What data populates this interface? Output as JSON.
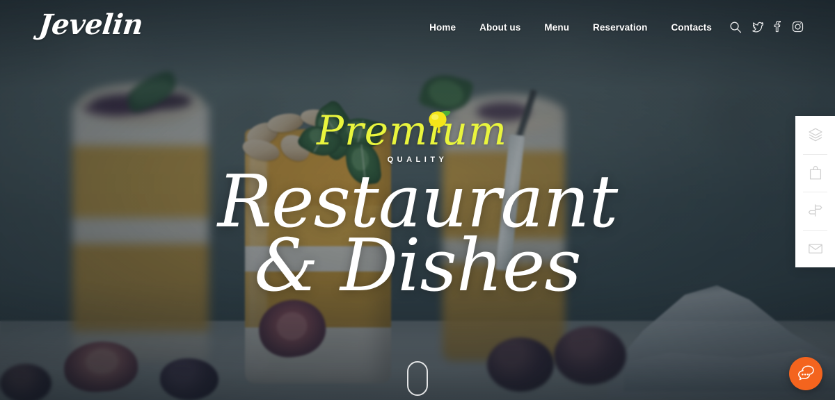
{
  "site": {
    "logo_text": "Jevelin",
    "brand_accent": "#e9f53d",
    "chat_accent": "#f4641e"
  },
  "header": {
    "nav_items": [
      {
        "label": "Home",
        "name": "nav-item-home"
      },
      {
        "label": "About us",
        "name": "nav-item-about-us"
      },
      {
        "label": "Menu",
        "name": "nav-item-menu"
      },
      {
        "label": "Reservation",
        "name": "nav-item-reservation"
      },
      {
        "label": "Contacts",
        "name": "nav-item-contacts"
      }
    ],
    "icons": [
      {
        "icon": "search-icon",
        "label": "Search"
      },
      {
        "icon": "twitter-icon",
        "label": "Twitter"
      },
      {
        "icon": "facebook-icon",
        "label": "Facebook"
      },
      {
        "icon": "instagram-icon",
        "label": "Instagram"
      }
    ]
  },
  "hero": {
    "eyebrow_script": "Premium",
    "eyebrow_sub": "QUALITY",
    "headline_line1": "Restaurant",
    "headline_line2": "& Dishes",
    "badge_icon": "lemon-icon",
    "scroll_indicator": "scroll-mouse-icon"
  },
  "side_panel": {
    "buttons": [
      {
        "icon": "layers-icon",
        "label": "Layers"
      },
      {
        "icon": "bag-icon",
        "label": "Shop"
      },
      {
        "icon": "signpost-icon",
        "label": "Directions"
      },
      {
        "icon": "envelope-icon",
        "label": "Contact"
      }
    ]
  },
  "chat": {
    "icon": "chat-bubbles-icon",
    "label": "Chat"
  }
}
